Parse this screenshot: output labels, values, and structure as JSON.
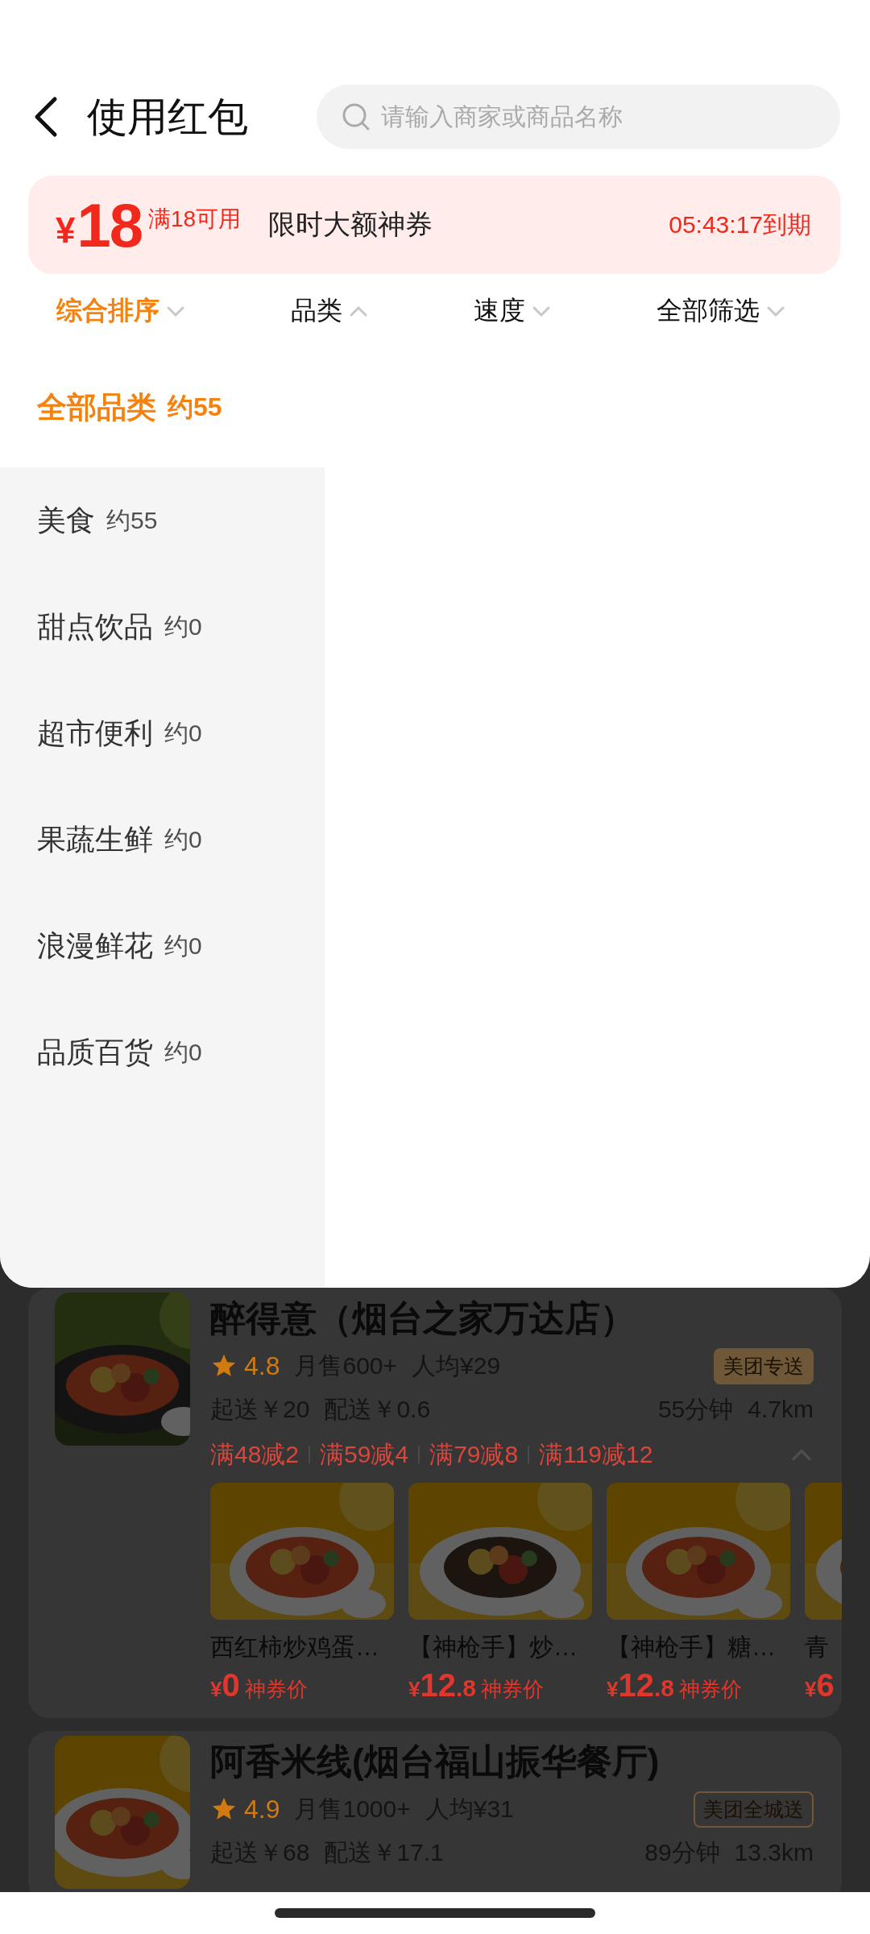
{
  "header": {
    "title": "使用红包",
    "search": {
      "placeholder": "请输入商家或商品名称"
    }
  },
  "coupon": {
    "currency": "¥",
    "amount": "18",
    "condition": "满18可用",
    "title": "限时大额神券",
    "expiry": "05:43:17到期"
  },
  "filters": [
    {
      "label": "综合排序",
      "selected": true,
      "expanded": false
    },
    {
      "label": "品类",
      "selected": false,
      "expanded": true
    },
    {
      "label": "速度",
      "selected": false,
      "expanded": false
    },
    {
      "label": "全部筛选",
      "selected": false,
      "expanded": false
    }
  ],
  "category_panel": {
    "all": {
      "name": "全部品类",
      "count": "约55",
      "selected": true
    },
    "items": [
      {
        "name": "美食",
        "count": "约55",
        "selected": false
      },
      {
        "name": "甜点饮品",
        "count": "约0",
        "selected": false
      },
      {
        "name": "超市便利",
        "count": "约0",
        "selected": false
      },
      {
        "name": "果蔬生鲜",
        "count": "约0",
        "selected": false
      },
      {
        "name": "浪漫鲜花",
        "count": "约0",
        "selected": false
      },
      {
        "name": "品质百货",
        "count": "约0",
        "selected": false
      }
    ]
  },
  "stores": [
    {
      "name": "醉得意（烟台之家万达店）",
      "rating": "4.8",
      "monthly_sales": "月售600+",
      "per_capita": "人均¥29",
      "badge": {
        "text": "美团专送",
        "kind": "filled"
      },
      "min_order": "起送￥20",
      "delivery_fee": "配送￥0.6",
      "time": "55分钟",
      "distance": "4.7km",
      "promos": [
        "满48减2",
        "满59减4",
        "满79减8",
        "满119减12"
      ],
      "dishes": [
        {
          "name": "西红柿炒鸡蛋…",
          "price": {
            "currency": "¥",
            "integer": "0",
            "label": "神券价"
          }
        },
        {
          "name": "【神枪手】炒…",
          "price": {
            "currency": "¥",
            "integer": "12",
            "decimal": ".8",
            "label": "神券价"
          }
        },
        {
          "name": "【神枪手】糖…",
          "price": {
            "currency": "¥",
            "integer": "12",
            "decimal": ".8",
            "label": "神券价"
          }
        },
        {
          "name": "青",
          "price": {
            "currency": "¥",
            "integer": "6"
          }
        }
      ]
    },
    {
      "name": "阿香米线(烟台福山振华餐厅)",
      "rating": "4.9",
      "monthly_sales": "月售1000+",
      "per_capita": "人均¥31",
      "badge": {
        "text": "美团全城送",
        "kind": "outlined"
      },
      "min_order": "起送￥68",
      "delivery_fee": "配送￥17.1",
      "time": "89分钟",
      "distance": "13.3km"
    }
  ]
}
